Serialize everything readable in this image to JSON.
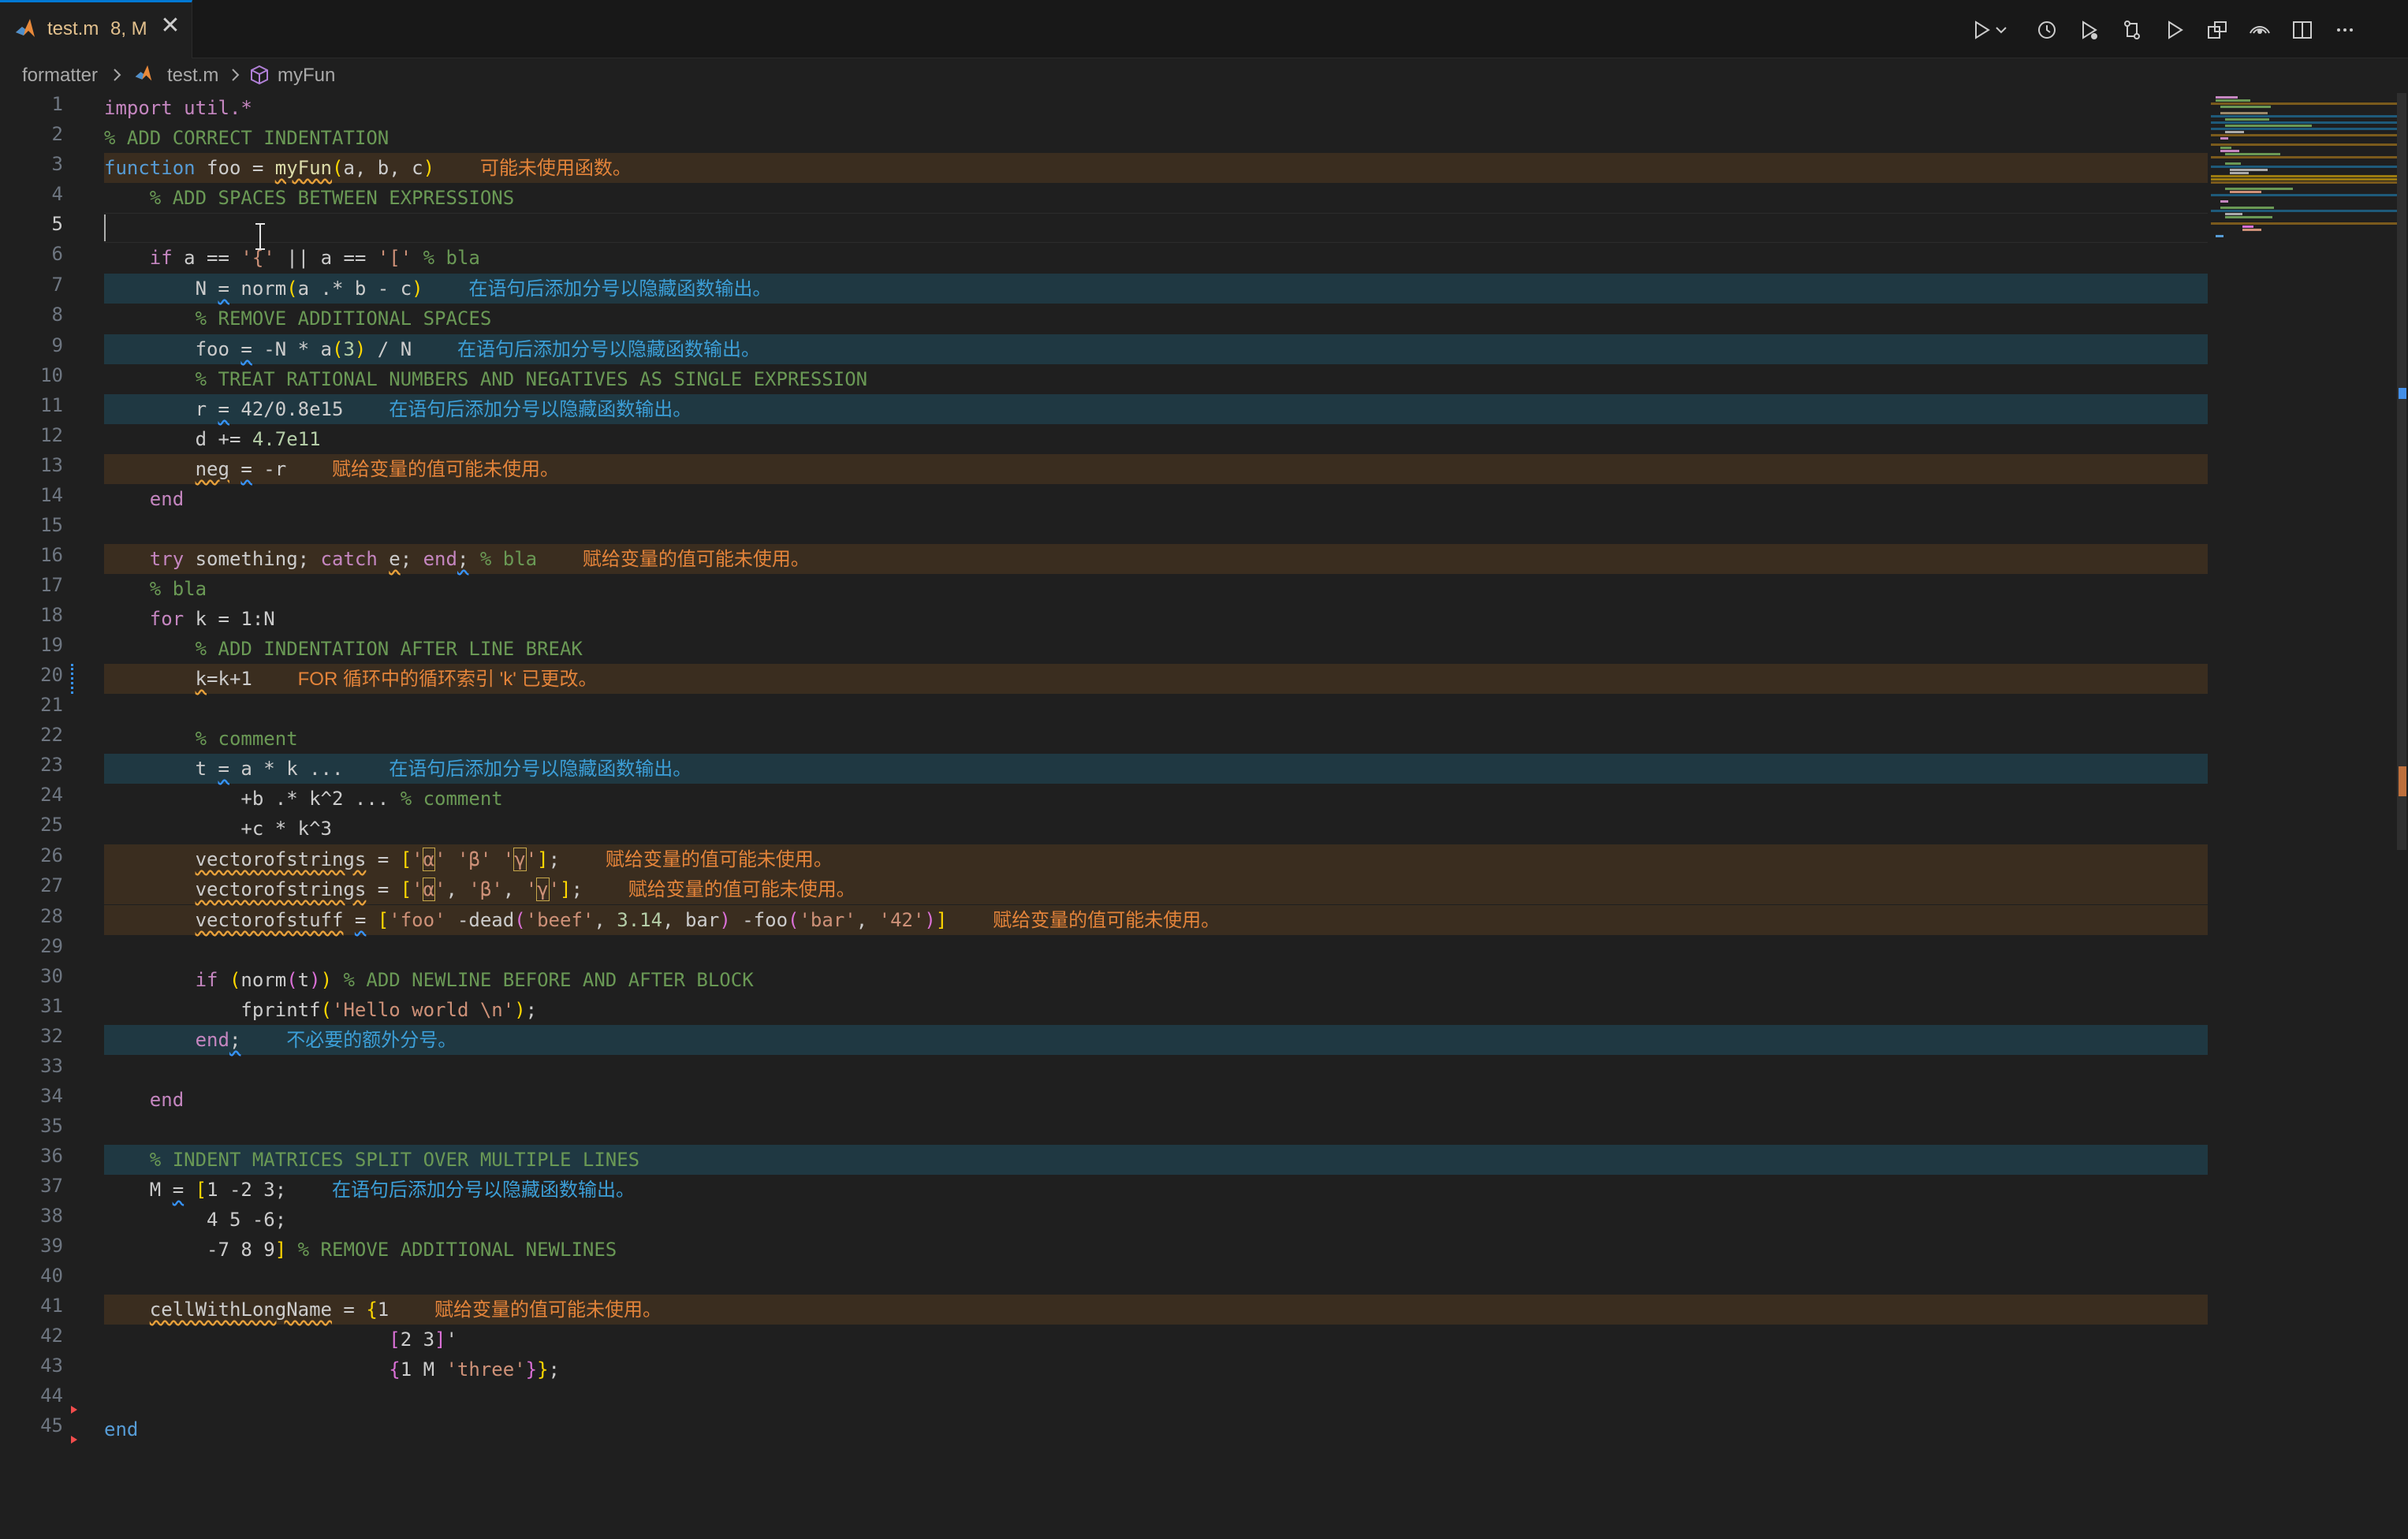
{
  "tab": {
    "filename": "test.m",
    "badge": "8, M",
    "close_glyph": "✕",
    "icon": "matlab-icon"
  },
  "toolbar": {
    "icons": [
      "run-icon",
      "run-dropdown-icon",
      "history-icon",
      "debug-run-icon",
      "compare-changes-icon",
      "run-file-icon",
      "open-changes-icon",
      "broadcast-icon",
      "split-editor-icon",
      "more-actions-icon"
    ]
  },
  "breadcrumb": {
    "folder": "formatter",
    "file": "test.m",
    "symbol": "myFun"
  },
  "colors": {
    "warning": "#e4843a",
    "info": "#3c9fd8",
    "background": "#1f1f1f"
  },
  "editor": {
    "active_line": 5,
    "line_numbers": [
      "1",
      "2",
      "3",
      "4",
      "5",
      "6",
      "7",
      "8",
      "9",
      "10",
      "11",
      "12",
      "13",
      "14",
      "15",
      "16",
      "17",
      "18",
      "19",
      "20",
      "21",
      "22",
      "23",
      "24",
      "25",
      "26",
      "27",
      "28",
      "29",
      "30",
      "31",
      "32",
      "33",
      "34",
      "35",
      "36",
      "37",
      "38",
      "39",
      "40",
      "41",
      "42",
      "43",
      "44",
      "45"
    ],
    "messages": {
      "unused_function": "可能未使用函数。",
      "add_semicolon": "在语句后添加分号以隐藏函数输出。",
      "unused_value": "赋给变量的值可能未使用。",
      "loop_index_changed": "FOR 循环中的循环索引 'k' 已更改。",
      "extra_semicolon": "不必要的额外分号。"
    },
    "code": {
      "l1": [
        "import util.*"
      ],
      "l2": [
        "% ADD CORRECT INDENTATION"
      ],
      "l3": [
        "function",
        " foo = ",
        "myFun",
        "(",
        "a, b, c",
        ")"
      ],
      "l4": [
        "    % ADD SPACES BETWEEN EXPRESSIONS"
      ],
      "l6": [
        "    ",
        "if",
        " a == ",
        "'{'",
        " || a == ",
        "'['",
        " ",
        "% bla"
      ],
      "l7": [
        "        N ",
        "=",
        " norm",
        "(",
        "a .* b - c",
        ")"
      ],
      "l8": [
        "        % REMOVE ADDITIONAL SPACES"
      ],
      "l9": [
        "        foo ",
        "=",
        " -N * a",
        "(",
        "3",
        ")",
        " / N"
      ],
      "l10": [
        "        % TREAT RATIONAL NUMBERS AND NEGATIVES AS SINGLE EXPRESSION"
      ],
      "l11": [
        "        r ",
        "=",
        " 42/0.8e15"
      ],
      "l12": [
        "        d += ",
        "4.7e11"
      ],
      "l13": [
        "        ",
        "neg",
        " ",
        "=",
        " -r"
      ],
      "l14": [
        "    ",
        "end"
      ],
      "l16": [
        "    ",
        "try",
        " something; ",
        "catch",
        " ",
        "e",
        "; ",
        "end",
        ";",
        " ",
        "% bla"
      ],
      "l17": [
        "    % bla"
      ],
      "l18": [
        "    ",
        "for",
        " k = 1:N"
      ],
      "l19": [
        "        % ADD INDENTATION AFTER LINE BREAK"
      ],
      "l20": [
        "        ",
        "k",
        "=k+1"
      ],
      "l22": [
        "        % comment"
      ],
      "l23": [
        "        t ",
        "=",
        " a * k ..."
      ],
      "l24": [
        "            +b .* k^2 ... ",
        "% comment"
      ],
      "l25": [
        "            +c * k^3"
      ],
      "l26": [
        "        ",
        "vectorofstrings",
        " = ",
        "[",
        "'",
        "α",
        "'",
        " ",
        "'β'",
        " ",
        "'",
        "γ",
        "'",
        "]",
        ";"
      ],
      "l27": [
        "        ",
        "vectorofstrings",
        " = ",
        "[",
        "'",
        "α",
        "'",
        ", ",
        "'β'",
        ", ",
        "'",
        "γ",
        "'",
        "]",
        ";"
      ],
      "l28": [
        "        ",
        "vectorofstuff",
        " ",
        "=",
        " ",
        "[",
        "'foo'",
        " -dead",
        "(",
        "'beef'",
        ", ",
        "3.14",
        ", bar",
        ")",
        " -foo",
        "(",
        "'bar'",
        ", ",
        "'42'",
        ")",
        "]"
      ],
      "l30": [
        "        ",
        "if",
        " ",
        "(",
        "norm",
        "(",
        "t",
        ")",
        ")",
        " ",
        "% ADD NEWLINE BEFORE AND AFTER BLOCK"
      ],
      "l31": [
        "            fprintf",
        "(",
        "'Hello world \\n'",
        ")",
        ";"
      ],
      "l32": [
        "        ",
        "end",
        ";"
      ],
      "l34": [
        "    ",
        "end"
      ],
      "l36": [
        "    % INDENT MATRICES SPLIT OVER MULTIPLE LINES"
      ],
      "l37": [
        "    M ",
        "=",
        " ",
        "[",
        "1 -2 3;"
      ],
      "l38": [
        "         4 5 -6;"
      ],
      "l39": [
        "         -7 8 9",
        "]",
        " ",
        "% REMOVE ADDITIONAL NEWLINES"
      ],
      "l41": [
        "    ",
        "cellWithLongName",
        " = ",
        "{",
        "1"
      ],
      "l42": [
        "                         ",
        "[",
        "2 3",
        "]",
        "'"
      ],
      "l43": [
        "                         ",
        "{",
        "1 M ",
        "'three'",
        "}",
        "}",
        ";"
      ],
      "l45": [
        "end"
      ]
    }
  }
}
